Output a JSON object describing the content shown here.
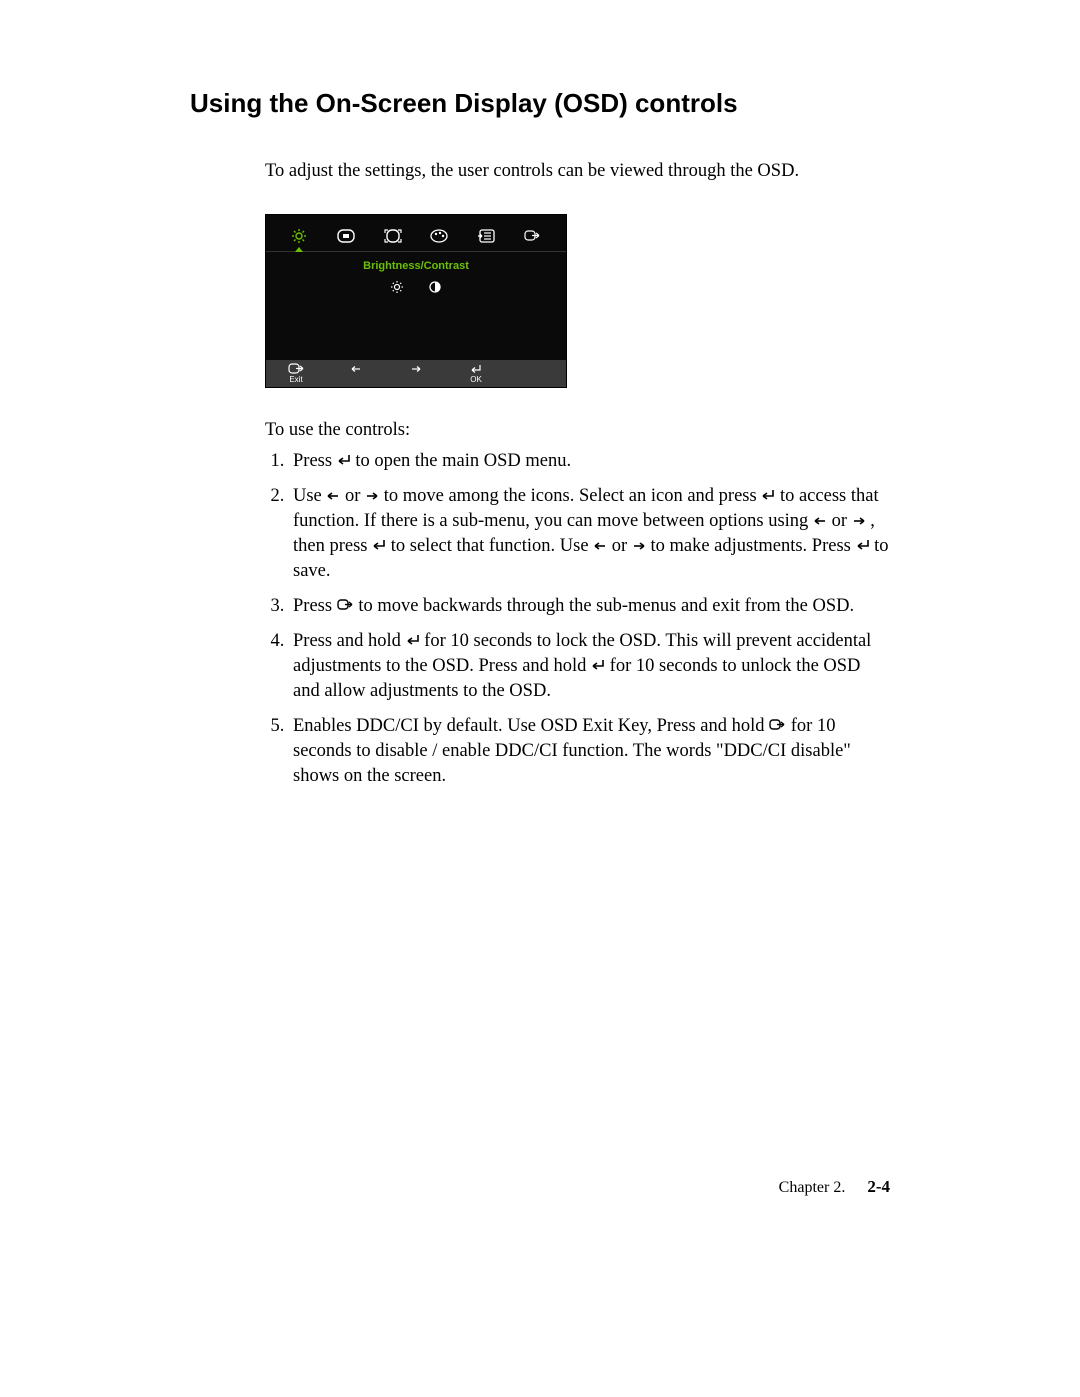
{
  "heading": "Using the On-Screen Display (OSD) controls",
  "intro": "To adjust the settings,  the user controls can be viewed through the OSD.",
  "osd": {
    "subtitle": "Brightness/Contrast",
    "footer": {
      "exit_label": "Exit",
      "ok_label": "OK"
    }
  },
  "controls_lead": "To use the controls:",
  "steps": {
    "s1a": "Press ",
    "s1b": " to open the main OSD menu.",
    "s2a": "Use ",
    "s2b": " or ",
    "s2c": " to move among the icons. Select an icon and press  ",
    "s2d": " to access that function. If there is a sub-menu, you can move between options using ",
    "s2e": " or ",
    "s2f": " , then press  ",
    "s2g": " to select that function. Use ",
    "s2h": " or ",
    "s2i": " to make adjustments. Press ",
    "s2j": " to save.",
    "s3a": "Press ",
    "s3b": " to move backwards through the sub-menus and exit from the OSD.",
    "s4a": "Press and hold  ",
    "s4b": "  for 10 seconds to lock the OSD. This will prevent accidental adjustments to the OSD. Press and hold ",
    "s4c": "  for 10 seconds to unlock the OSD and allow adjustments to the OSD.",
    "s5a": "Enables DDC/CI by default. Use OSD Exit Key,  Press and hold ",
    "s5b": " for 10 seconds to disable / enable DDC/CI function. The words \"DDC/CI disable\" shows on the screen."
  },
  "footer": {
    "chapter": "Chapter 2.",
    "page": "2-4"
  }
}
